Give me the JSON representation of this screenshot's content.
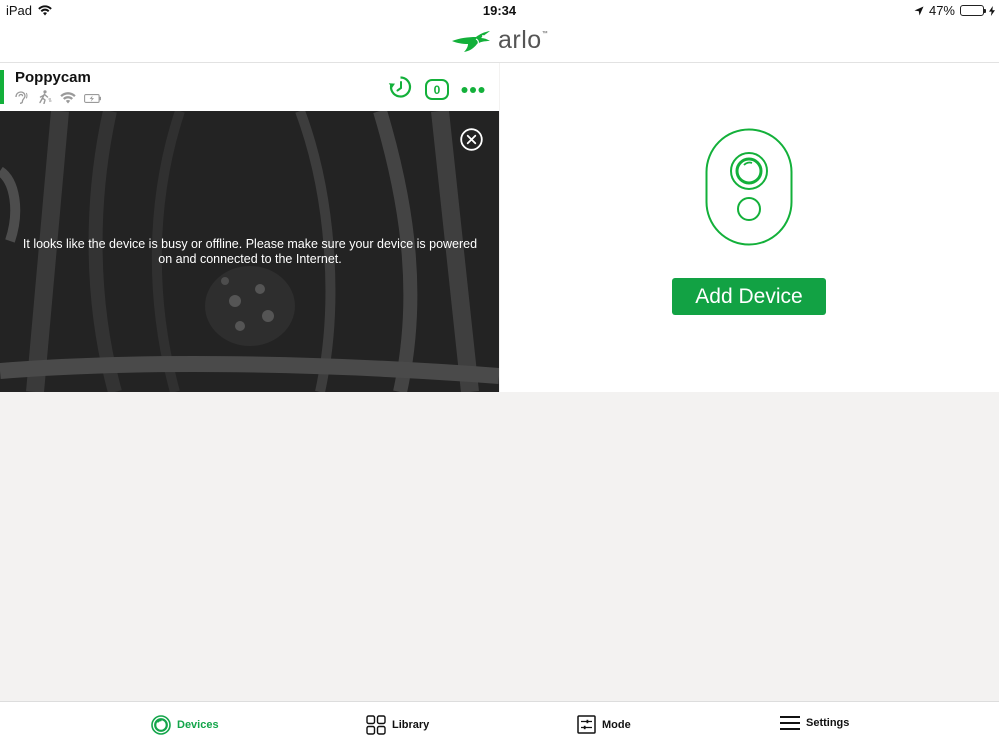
{
  "status_bar": {
    "device": "iPad",
    "time": "19:34",
    "battery_percent": "47%",
    "battery_level": 0.47
  },
  "header": {
    "logo_text": "arlo",
    "logo_tm": "™"
  },
  "device_card": {
    "name": "Poppycam",
    "status_icons": [
      "audio-icon",
      "motion-icon",
      "wifi-signal-icon",
      "battery-charging-icon"
    ],
    "actions": {
      "history_icon": "history-icon",
      "notification_count": "0",
      "more_icon": "more-dots-icon"
    },
    "feed_message": "It looks like the device is busy or offline. Please make sure your device is powered on and connected to the Internet.",
    "close_icon": "close-circle-icon"
  },
  "add_panel": {
    "camera_icon": "arlo-camera-icon",
    "button_label": "Add Device"
  },
  "tabs": [
    {
      "label": "Devices",
      "icon": "devices-icon",
      "active": true
    },
    {
      "label": "Library",
      "icon": "library-grid-icon",
      "active": false
    },
    {
      "label": "Mode",
      "icon": "mode-sliders-icon",
      "active": false
    },
    {
      "label": "Settings",
      "icon": "menu-lines-icon",
      "active": false
    }
  ],
  "colors": {
    "brand_green": "#13b03a",
    "button_green": "#12a244",
    "background": "#f3f2f1"
  }
}
